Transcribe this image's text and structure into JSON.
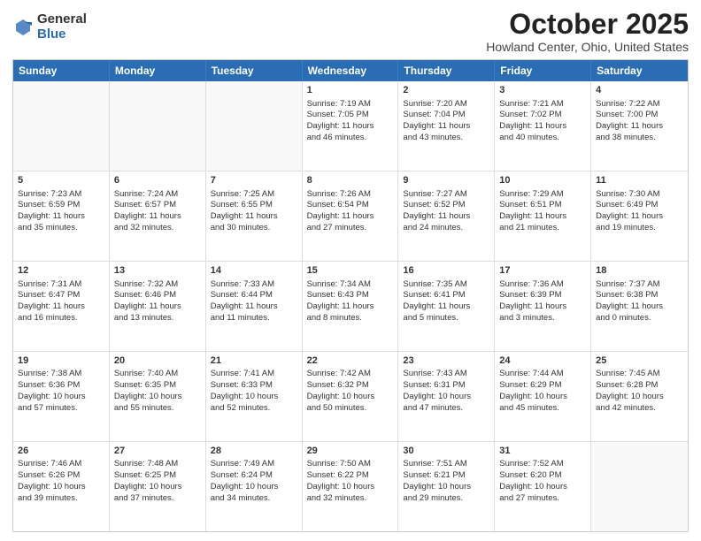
{
  "logo": {
    "general": "General",
    "blue": "Blue"
  },
  "title": "October 2025",
  "location": "Howland Center, Ohio, United States",
  "headers": [
    "Sunday",
    "Monday",
    "Tuesday",
    "Wednesday",
    "Thursday",
    "Friday",
    "Saturday"
  ],
  "rows": [
    [
      {
        "day": "",
        "text": ""
      },
      {
        "day": "",
        "text": ""
      },
      {
        "day": "",
        "text": ""
      },
      {
        "day": "1",
        "text": "Sunrise: 7:19 AM\nSunset: 7:05 PM\nDaylight: 11 hours\nand 46 minutes."
      },
      {
        "day": "2",
        "text": "Sunrise: 7:20 AM\nSunset: 7:04 PM\nDaylight: 11 hours\nand 43 minutes."
      },
      {
        "day": "3",
        "text": "Sunrise: 7:21 AM\nSunset: 7:02 PM\nDaylight: 11 hours\nand 40 minutes."
      },
      {
        "day": "4",
        "text": "Sunrise: 7:22 AM\nSunset: 7:00 PM\nDaylight: 11 hours\nand 38 minutes."
      }
    ],
    [
      {
        "day": "5",
        "text": "Sunrise: 7:23 AM\nSunset: 6:59 PM\nDaylight: 11 hours\nand 35 minutes."
      },
      {
        "day": "6",
        "text": "Sunrise: 7:24 AM\nSunset: 6:57 PM\nDaylight: 11 hours\nand 32 minutes."
      },
      {
        "day": "7",
        "text": "Sunrise: 7:25 AM\nSunset: 6:55 PM\nDaylight: 11 hours\nand 30 minutes."
      },
      {
        "day": "8",
        "text": "Sunrise: 7:26 AM\nSunset: 6:54 PM\nDaylight: 11 hours\nand 27 minutes."
      },
      {
        "day": "9",
        "text": "Sunrise: 7:27 AM\nSunset: 6:52 PM\nDaylight: 11 hours\nand 24 minutes."
      },
      {
        "day": "10",
        "text": "Sunrise: 7:29 AM\nSunset: 6:51 PM\nDaylight: 11 hours\nand 21 minutes."
      },
      {
        "day": "11",
        "text": "Sunrise: 7:30 AM\nSunset: 6:49 PM\nDaylight: 11 hours\nand 19 minutes."
      }
    ],
    [
      {
        "day": "12",
        "text": "Sunrise: 7:31 AM\nSunset: 6:47 PM\nDaylight: 11 hours\nand 16 minutes."
      },
      {
        "day": "13",
        "text": "Sunrise: 7:32 AM\nSunset: 6:46 PM\nDaylight: 11 hours\nand 13 minutes."
      },
      {
        "day": "14",
        "text": "Sunrise: 7:33 AM\nSunset: 6:44 PM\nDaylight: 11 hours\nand 11 minutes."
      },
      {
        "day": "15",
        "text": "Sunrise: 7:34 AM\nSunset: 6:43 PM\nDaylight: 11 hours\nand 8 minutes."
      },
      {
        "day": "16",
        "text": "Sunrise: 7:35 AM\nSunset: 6:41 PM\nDaylight: 11 hours\nand 5 minutes."
      },
      {
        "day": "17",
        "text": "Sunrise: 7:36 AM\nSunset: 6:39 PM\nDaylight: 11 hours\nand 3 minutes."
      },
      {
        "day": "18",
        "text": "Sunrise: 7:37 AM\nSunset: 6:38 PM\nDaylight: 11 hours\nand 0 minutes."
      }
    ],
    [
      {
        "day": "19",
        "text": "Sunrise: 7:38 AM\nSunset: 6:36 PM\nDaylight: 10 hours\nand 57 minutes."
      },
      {
        "day": "20",
        "text": "Sunrise: 7:40 AM\nSunset: 6:35 PM\nDaylight: 10 hours\nand 55 minutes."
      },
      {
        "day": "21",
        "text": "Sunrise: 7:41 AM\nSunset: 6:33 PM\nDaylight: 10 hours\nand 52 minutes."
      },
      {
        "day": "22",
        "text": "Sunrise: 7:42 AM\nSunset: 6:32 PM\nDaylight: 10 hours\nand 50 minutes."
      },
      {
        "day": "23",
        "text": "Sunrise: 7:43 AM\nSunset: 6:31 PM\nDaylight: 10 hours\nand 47 minutes."
      },
      {
        "day": "24",
        "text": "Sunrise: 7:44 AM\nSunset: 6:29 PM\nDaylight: 10 hours\nand 45 minutes."
      },
      {
        "day": "25",
        "text": "Sunrise: 7:45 AM\nSunset: 6:28 PM\nDaylight: 10 hours\nand 42 minutes."
      }
    ],
    [
      {
        "day": "26",
        "text": "Sunrise: 7:46 AM\nSunset: 6:26 PM\nDaylight: 10 hours\nand 39 minutes."
      },
      {
        "day": "27",
        "text": "Sunrise: 7:48 AM\nSunset: 6:25 PM\nDaylight: 10 hours\nand 37 minutes."
      },
      {
        "day": "28",
        "text": "Sunrise: 7:49 AM\nSunset: 6:24 PM\nDaylight: 10 hours\nand 34 minutes."
      },
      {
        "day": "29",
        "text": "Sunrise: 7:50 AM\nSunset: 6:22 PM\nDaylight: 10 hours\nand 32 minutes."
      },
      {
        "day": "30",
        "text": "Sunrise: 7:51 AM\nSunset: 6:21 PM\nDaylight: 10 hours\nand 29 minutes."
      },
      {
        "day": "31",
        "text": "Sunrise: 7:52 AM\nSunset: 6:20 PM\nDaylight: 10 hours\nand 27 minutes."
      },
      {
        "day": "",
        "text": ""
      }
    ]
  ]
}
